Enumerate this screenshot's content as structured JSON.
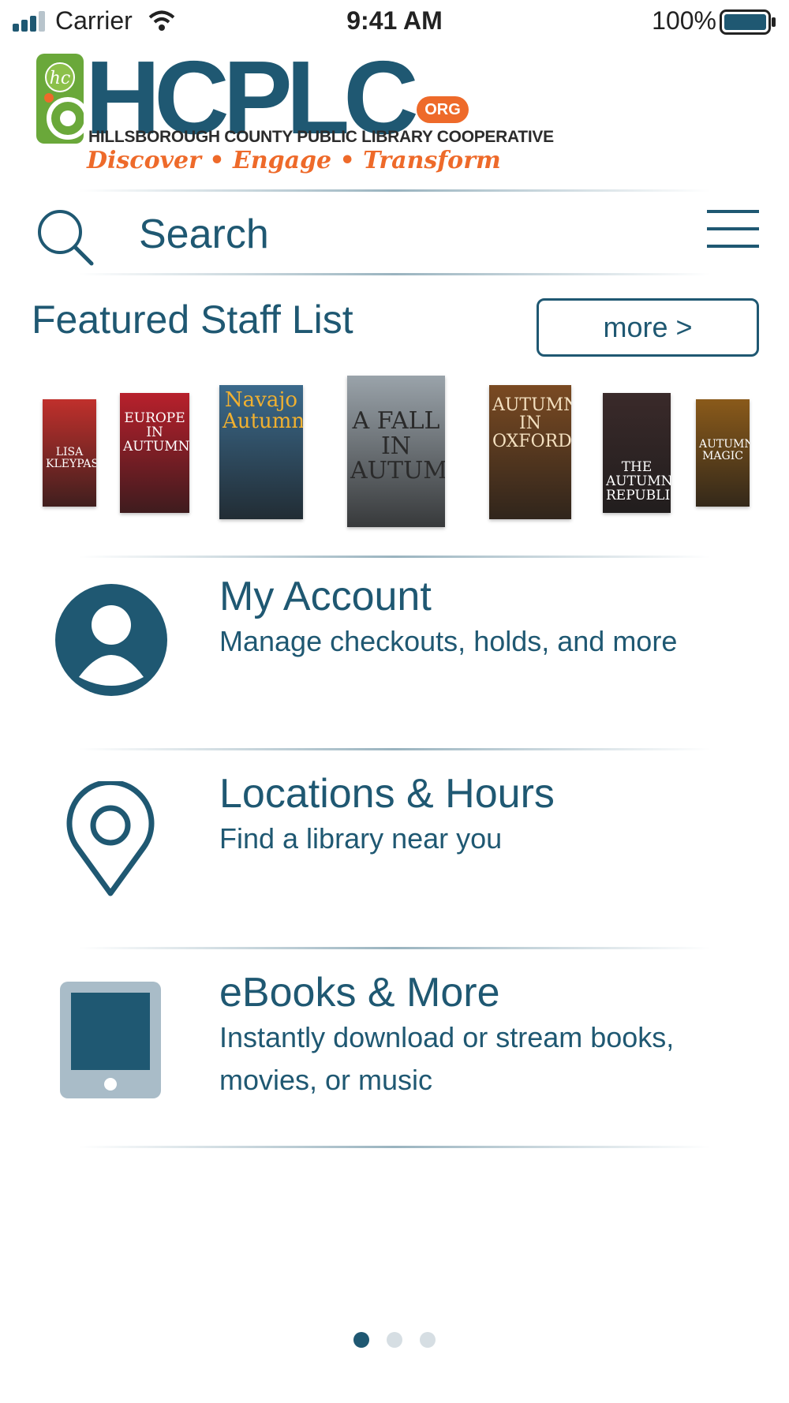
{
  "status_bar": {
    "carrier": "Carrier",
    "time": "9:41 AM",
    "battery": "100%"
  },
  "logo": {
    "main_text": "HCPLC",
    "org_badge": "ORG",
    "subtitle": "HILLSBOROUGH COUNTY PUBLIC LIBRARY COOPERATIVE",
    "tagline": "Discover • Engage • Transform",
    "emblem_text": "hc"
  },
  "search": {
    "placeholder": "Search"
  },
  "featured": {
    "title": "Featured Staff List",
    "more_label": "more >",
    "books": [
      {
        "title": "LISA KLEYPAS",
        "color": "#c0302c"
      },
      {
        "title": "EUROPE IN AUTUMN",
        "color": "#b8202c"
      },
      {
        "title": "Navajo Autumn",
        "color": "#3b6a8c"
      },
      {
        "title": "A FALL IN AUTUMN",
        "color": "#9aa3aa"
      },
      {
        "title": "AUTUMN IN OXFORD",
        "color": "#7a4a22"
      },
      {
        "title": "THE AUTUMN REPUBLIC",
        "color": "#3a2a2a"
      },
      {
        "title": "AUTUMN MAGIC",
        "color": "#8a5a1a"
      }
    ]
  },
  "menu": [
    {
      "title": "My Account",
      "subtitle": "Manage checkouts, holds, and more",
      "icon": "user-icon"
    },
    {
      "title": "Locations & Hours",
      "subtitle": "Find a library near you",
      "icon": "location-pin-icon"
    },
    {
      "title": "eBooks & More",
      "subtitle": "Instantly download or stream books, movies, or music",
      "icon": "tablet-icon"
    }
  ],
  "pager": {
    "pages": 3,
    "current": 1
  },
  "colors": {
    "brand": "#1f5872",
    "accent": "#ee6a2a",
    "tablet_frame": "#a9bcc8"
  }
}
